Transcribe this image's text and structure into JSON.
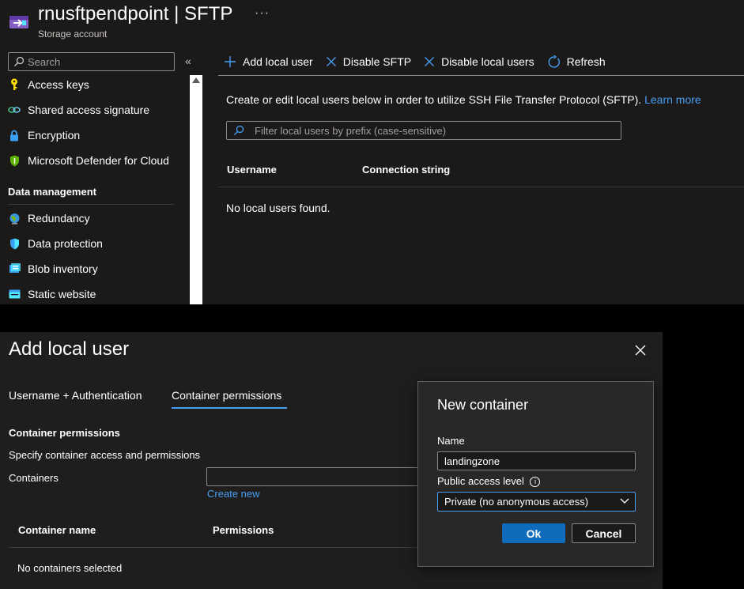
{
  "resource": {
    "name": "rnusftpendpoint",
    "separator": "|",
    "page": "SFTP",
    "more": "···",
    "type": "Storage account"
  },
  "sidebar": {
    "search_placeholder": "Search",
    "collapse_glyph": "«",
    "items_top": [
      {
        "label": "Access keys",
        "icon": "key-icon"
      },
      {
        "label": "Shared access signature",
        "icon": "link-icon"
      },
      {
        "label": "Encryption",
        "icon": "lock-icon"
      },
      {
        "label": "Microsoft Defender for Cloud",
        "icon": "shield-icon"
      }
    ],
    "section_label": "Data management",
    "items_data": [
      {
        "label": "Redundancy",
        "icon": "globe-icon"
      },
      {
        "label": "Data protection",
        "icon": "data-protection-icon"
      },
      {
        "label": "Blob inventory",
        "icon": "inventory-icon"
      },
      {
        "label": "Static website",
        "icon": "website-icon"
      }
    ]
  },
  "toolbar": {
    "add_local_user": "Add local user",
    "disable_sftp": "Disable SFTP",
    "disable_local_users": "Disable local users",
    "refresh": "Refresh"
  },
  "main": {
    "info_text": "Create or edit local users below in order to utilize SSH File Transfer Protocol (SFTP).",
    "learn_more": "Learn more",
    "filter_placeholder": "Filter local users by prefix (case-sensitive)",
    "columns": [
      "Username",
      "Connection string"
    ],
    "empty_text": "No local users found."
  },
  "panel": {
    "title": "Add local user",
    "tabs": [
      "Username + Authentication",
      "Container permissions"
    ],
    "active_tab": "Container permissions",
    "section_title": "Container permissions",
    "section_desc": "Specify container access and permissions",
    "containers_label": "Containers",
    "containers_value": "",
    "create_new": "Create new",
    "columns": [
      "Container name",
      "Permissions"
    ],
    "empty_text": "No containers selected"
  },
  "new_container": {
    "title": "New container",
    "name_label": "Name",
    "name_value": "landingzone",
    "access_label": "Public access level",
    "access_value": "Private (no anonymous access)",
    "ok": "Ok",
    "cancel": "Cancel"
  },
  "colors": {
    "accent": "#479ef5",
    "primary_button": "#0f6cbd",
    "top_background": "#1b1a19",
    "panel_background": "#1f1e1d"
  }
}
